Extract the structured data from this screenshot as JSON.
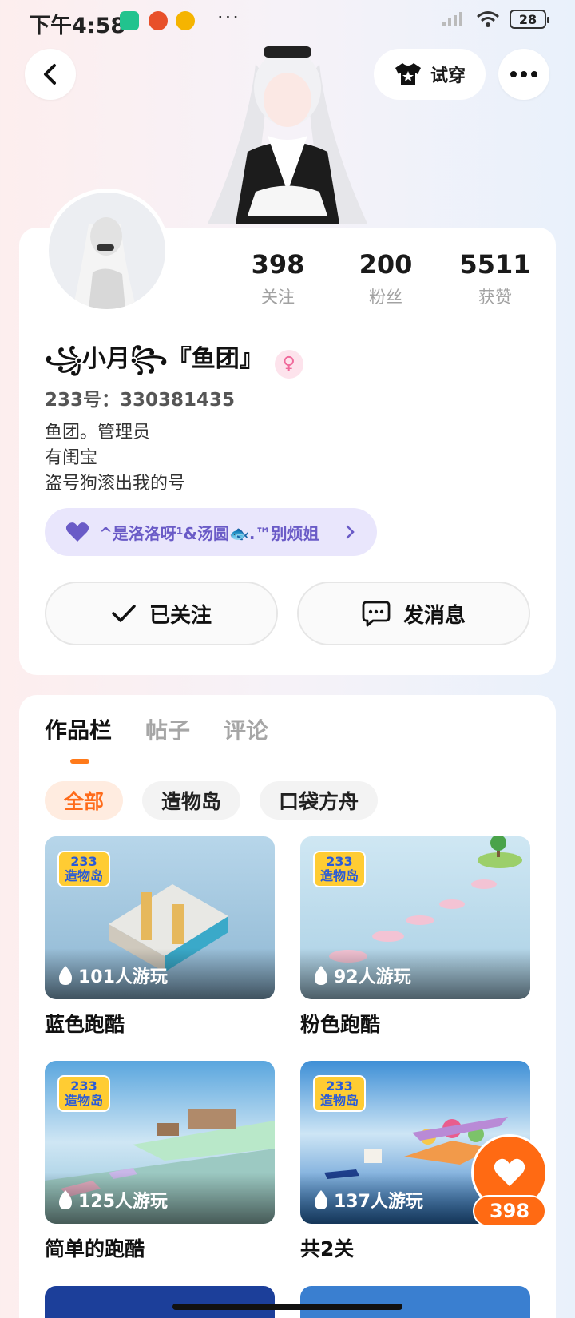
{
  "status_bar": {
    "time": "下午4:58",
    "dots": "···",
    "battery": "28"
  },
  "header": {
    "back_icon": "chevron-left-icon",
    "tryon_label": "试穿",
    "tryon_icon": "shirt-icon",
    "more_icon": "more-dots-icon"
  },
  "profile": {
    "stats": [
      {
        "value": "398",
        "label": "关注"
      },
      {
        "value": "200",
        "label": "粉丝"
      },
      {
        "value": "5511",
        "label": "获赞"
      }
    ],
    "nickname": "꧁小月꧂『鱼团』",
    "gender_symbol": "♀",
    "uid": "233号：330381435",
    "bio": [
      "鱼团。管理员",
      "有闺宝",
      "盗号狗滚出我的号"
    ],
    "guard_tag": "^是洛洛呀¹&汤圆🐟.™别烦姐",
    "follow_label": "已关注",
    "message_label": "发消息"
  },
  "tabs": [
    "作品栏",
    "帖子",
    "评论"
  ],
  "active_tab": 0,
  "chips": [
    "全部",
    "造物岛",
    "口袋方舟"
  ],
  "active_chip": 0,
  "games": [
    {
      "title": "蓝色跑酷",
      "plays": "101人游玩",
      "logo_top": "233",
      "logo_bottom": "造物岛",
      "bg": "#a8c9df"
    },
    {
      "title": "粉色跑酷",
      "plays": "92人游玩",
      "logo_top": "233",
      "logo_bottom": "造物岛",
      "bg": "#bfdff0"
    },
    {
      "title": "简单的跑酷",
      "plays": "125人游玩",
      "logo_top": "233",
      "logo_bottom": "造物岛",
      "bg": "#8fc3e6"
    },
    {
      "title": "共2关",
      "plays": "137人游玩",
      "logo_top": "233",
      "logo_bottom": "造物岛",
      "bg": "#6fb0e4"
    }
  ],
  "like_count": "398",
  "colors": {
    "accent": "#ff6a13",
    "guard_bg": "#e9e6fc",
    "guard_text": "#6a5bc7"
  }
}
